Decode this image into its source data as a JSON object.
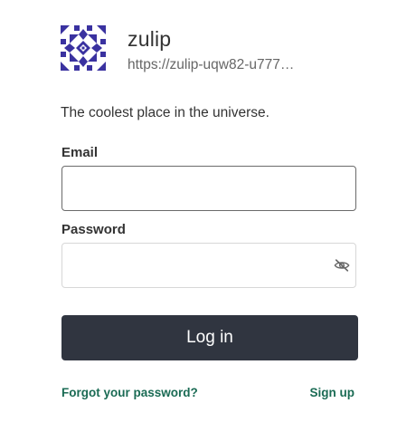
{
  "org": {
    "name": "zulip",
    "url": "https://zulip-uqw82-u777…",
    "description": "The coolest place in the universe.",
    "logo_icon": "zulip-org-logo",
    "logo_color": "#3a32a0"
  },
  "form": {
    "email_label": "Email",
    "email_value": "",
    "password_label": "Password",
    "password_value": "",
    "password_toggle_icon": "eye-slash-icon",
    "login_button_label": "Log in",
    "login_button_color": "#303540"
  },
  "links": {
    "forgot_password": "Forgot your password?",
    "sign_up": "Sign up",
    "link_color": "#1a6b54"
  }
}
